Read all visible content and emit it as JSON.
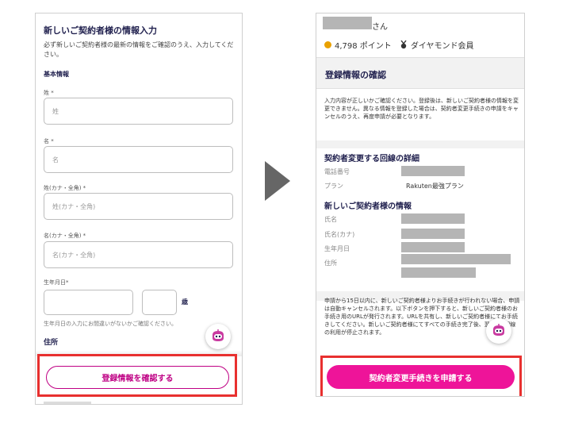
{
  "left": {
    "title": "新しいご契約者様の情報入力",
    "description": "必ず新しいご契約者様の最新の情報をご確認のうえ、入力してください。",
    "section_basic": "基本情報",
    "fields": [
      {
        "label": "姓 *",
        "placeholder": "姓"
      },
      {
        "label": "名 *",
        "placeholder": "名"
      },
      {
        "label": "姓(カナ・全角) *",
        "placeholder": "姓(カナ・全角)"
      },
      {
        "label": "名(カナ・全角) *",
        "placeholder": "名(カナ・全角)"
      }
    ],
    "birthdate_label": "生年月日*",
    "birthdate_unit": "歳",
    "birthdate_note": "生年月日の入力にお間違いがないかご確認ください。",
    "section_address": "住所",
    "confirm_button": "登録情報を確認する"
  },
  "right": {
    "name_suffix": "さん",
    "points": "4,798 ポイント",
    "rank": "ダイヤモンド会員",
    "title": "登録情報の確認",
    "description": "入力内容が正しいかご確認ください。登録後は、新しいご契約者様の情報を変更できません。異なる情報を登録した場合は、契約者変更手続きの申請をキャンセルのうえ、再度申請が必要となります。",
    "line_details": {
      "heading": "契約者変更する回線の詳細",
      "rows": [
        {
          "label": "電話番号",
          "value": ""
        },
        {
          "label": "プラン",
          "value": "Rakuten最強プラン"
        }
      ]
    },
    "new_contractor": {
      "heading": "新しいご契約者様の情報",
      "rows": [
        {
          "label": "氏名"
        },
        {
          "label": "氏名(カナ)"
        },
        {
          "label": "生年月日"
        },
        {
          "label": "住所"
        }
      ]
    },
    "notice": "申請から15日以内に、新しいご契約者様よりお手続きが行われない場合、申請は自動キャンセルされます。以下ボタンを押下すると、新しいご契約者様のお手続き用のURLが発行されます。URLを共有し、新しいご契約者様にてお手続きしてください。新しいご契約者様にてすべての手続き完了後、翌0時に回線の利用が停止されます。",
    "apply_button": "契約者変更手続きを申請する"
  },
  "colors": {
    "brand_magenta": "#bf0084",
    "apply_button": "#ee1499",
    "highlight_frame": "#e8302f",
    "heading_navy": "#1f1f4d",
    "arrow": "#666666"
  },
  "icons": {
    "chatbot": "robot-chat-icon",
    "arrow": "triangle-right-icon",
    "points": "coin-icon",
    "rank": "medal-icon"
  }
}
